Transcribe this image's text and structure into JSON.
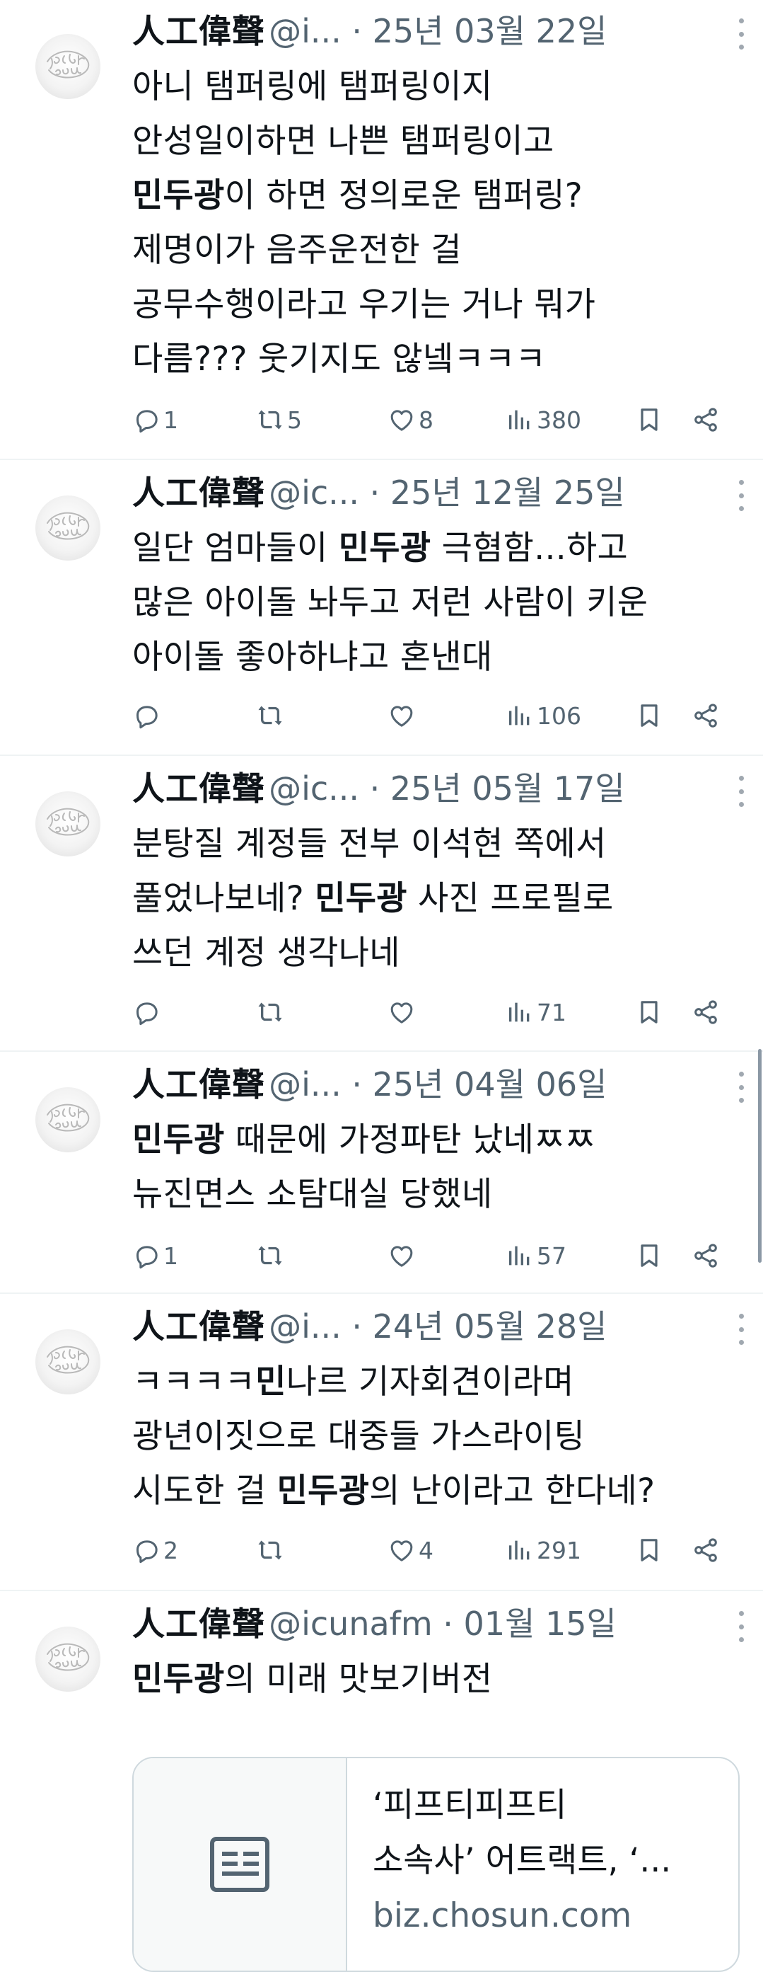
{
  "tweets": [
    {
      "name": "人工偉聲",
      "handle": "@i...",
      "date": "25년 03월 22일",
      "lines": [
        [
          {
            "t": "아니 탬퍼링에 탬퍼링이지"
          }
        ],
        [
          {
            "t": "안성일이하면 나쁜 탬퍼링이고"
          }
        ],
        [
          {
            "t": "민두광",
            "b": true
          },
          {
            "t": "이 하면 정의로운 탬퍼링?"
          }
        ],
        [
          {
            "t": "제명이가 음주운전한 걸"
          }
        ],
        [
          {
            "t": "공무수행이라고 우기는 거나 뭐가"
          }
        ],
        [
          {
            "t": "다름??? 웃기지도 않넼ㅋㅋㅋ"
          }
        ]
      ],
      "replies": "1",
      "retweets": "5",
      "likes": "8",
      "views": "380"
    },
    {
      "name": "人工偉聲",
      "handle": "@ic...",
      "date": "25년 12월 25일",
      "lines": [
        [
          {
            "t": "일단 엄마들이 "
          },
          {
            "t": "민두광",
            "b": true
          },
          {
            "t": " 극혐함...하고"
          }
        ],
        [
          {
            "t": "많은 아이돌 놔두고 저런 사람이 키운"
          }
        ],
        [
          {
            "t": "아이돌 좋아하냐고 혼낸대"
          }
        ]
      ],
      "replies": "",
      "retweets": "",
      "likes": "",
      "views": "106"
    },
    {
      "name": "人工偉聲",
      "handle": "@ic...",
      "date": "25년 05월 17일",
      "lines": [
        [
          {
            "t": "분탕질 계정들 전부 이석현 쪽에서"
          }
        ],
        [
          {
            "t": "풀었나보네?  "
          },
          {
            "t": "민두광",
            "b": true
          },
          {
            "t": " 사진 프로필로"
          }
        ],
        [
          {
            "t": "쓰던 계정 생각나네"
          }
        ]
      ],
      "replies": "",
      "retweets": "",
      "likes": "",
      "views": "71"
    },
    {
      "name": "人工偉聲",
      "handle": "@i...",
      "date": "25년 04월 06일",
      "lines": [
        [
          {
            "t": "민두광",
            "b": true
          },
          {
            "t": " 때문에 가정파탄 났네ㅉㅉ"
          }
        ],
        [
          {
            "t": "뉴진면스 소탐대실 당했네"
          }
        ]
      ],
      "replies": "1",
      "retweets": "",
      "likes": "",
      "views": "57"
    },
    {
      "name": "人工偉聲",
      "handle": "@i...",
      "date": "24년 05월 28일",
      "lines": [
        [
          {
            "t": "ㅋㅋㅋㅋ"
          },
          {
            "t": "민",
            "b": true
          },
          {
            "t": "나르 기자회견이라며"
          }
        ],
        [
          {
            "t": "광년이짓으로 대중들 가스라이팅"
          }
        ],
        [
          {
            "t": "시도한 걸 "
          },
          {
            "t": "민두광",
            "b": true
          },
          {
            "t": "의 난이라고 한다네?"
          }
        ]
      ],
      "replies": "2",
      "retweets": "",
      "likes": "4",
      "views": "291"
    },
    {
      "name": "人工偉聲",
      "handle": "@icunafm",
      "date": "01월 15일",
      "lines": [
        [
          {
            "t": "민두광",
            "b": true
          },
          {
            "t": "의 미래 맛보기버전"
          }
        ]
      ],
      "card": {
        "title_line1": "‘피프티피프티",
        "title_line2": "소속사’ 어트랙트, ‘...",
        "domain": "biz.chosun.com"
      }
    }
  ],
  "icons": {
    "reply": "reply-icon",
    "retweet": "retweet-icon",
    "like": "like-icon",
    "views": "views-icon",
    "bookmark": "bookmark-icon",
    "share": "share-icon",
    "more": "more-icon",
    "article": "article-icon"
  },
  "colors": {
    "text": "#0f1419",
    "secondary": "#536471",
    "divider": "#eff3f4"
  }
}
